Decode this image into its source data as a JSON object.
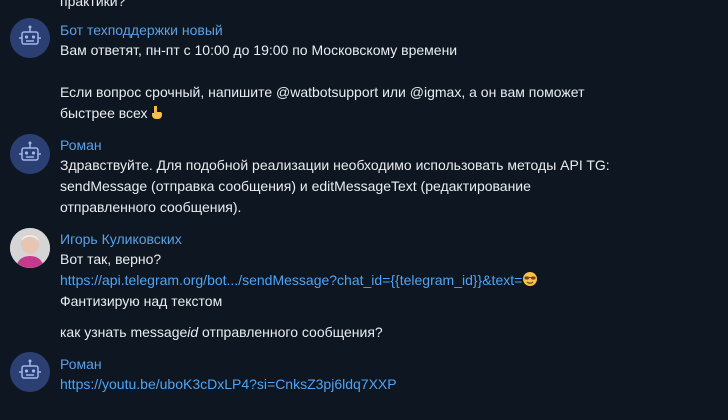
{
  "top_fragment": "практики?",
  "messages": [
    {
      "author": "Бот техподдержки новый",
      "lines": [
        "Вам ответят, пн-пт с 10:00 до 19:00 по Московскому времени",
        "Если вопрос срочный, напишите @watbotsupport или @igmax, а он вам поможет",
        "быстрее всех"
      ]
    },
    {
      "author": "Роман",
      "lines": [
        "Здравствуйте. Для подобной реализации необходимо использовать методы API TG:",
        "sendMessage (отправка сообщения) и editMessageText (редактирование",
        "отправленного сообщения)."
      ]
    },
    {
      "author": "Игорь Куликовских",
      "lines": [
        "Вот так, верно?",
        "https://api.telegram.org/bot.../sendMessage?chat_id={{telegram_id}}&text=",
        "Фантизирую над текстом",
        "как узнать message",
        "id",
        " отправленного сообщения?"
      ]
    },
    {
      "author": "Роман",
      "lines": [
        "https://youtu.be/uboK3cDxLP4?si=CnksZ3pj6ldq7XXP"
      ]
    }
  ],
  "icons": {
    "bot_avatar": "robot-icon",
    "pointing_emoji": "backhand-index-pointing-down-emoji",
    "sunglasses_emoji": "smiling-face-with-sunglasses-emoji"
  },
  "colors": {
    "background": "#0e1621",
    "author_name": "#5aa0e6",
    "link": "#4ea4f6",
    "text": "#e9edf0"
  }
}
